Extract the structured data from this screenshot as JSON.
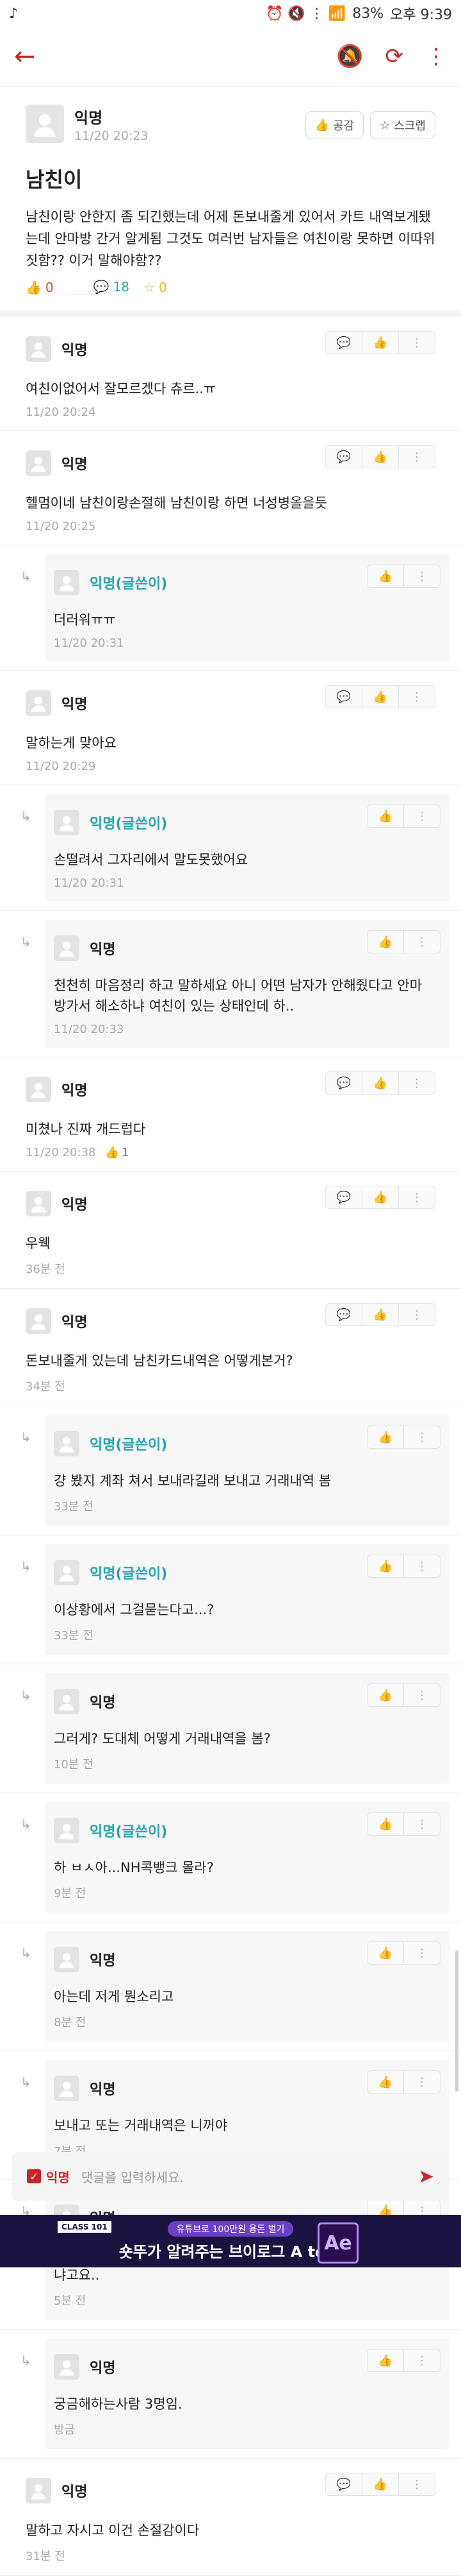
{
  "status": {
    "time": "오후 9:39",
    "battery": "83%"
  },
  "post": {
    "author": "익명",
    "date": "11/20 20:23",
    "empathy_label": "공감",
    "scrap_label": "스크랩",
    "title": "남친이",
    "body": "남친이랑 안한지 좀 되긴했는데 어제 돈보내줄게 있어서 카트 내역보게됐는데 안마방 간거 알게됨 그것도 여러번 남자들은 여친이랑 못하면 이따위짓함?? 이거 말해야함??",
    "likes": "0",
    "comments": "18",
    "scraps": "0"
  },
  "comments": [
    {
      "author": "익명",
      "text": "여친이없어서 잘모르겠다 츄르..ㅠ",
      "time": "11/20 20:24",
      "likes": ""
    },
    {
      "author": "익명",
      "text": "헬멈이네 남친이랑손절해 남친이랑 하면 너성병올을듯",
      "time": "11/20 20:25",
      "likes": "",
      "replies": [
        {
          "author": "익명(글쓴이)",
          "text": "더러워ㅠㅠ",
          "time": "11/20 20:31"
        }
      ]
    },
    {
      "author": "익명",
      "text": "말하는게 맞아요",
      "time": "11/20 20:29",
      "likes": "",
      "replies": [
        {
          "author": "익명(글쓴이)",
          "text": "손떨려서 그자리에서 말도못했어요",
          "time": "11/20 20:31"
        },
        {
          "author": "익명",
          "text": "천천히 마음정리 하고 말하세요 아니 어떤 남자가 안해줬다고 안마방가서 해소하냐 여친이 있는 상태인데 하..",
          "time": "11/20 20:33"
        }
      ]
    },
    {
      "author": "익명",
      "text": "미쳤나 진짜 개드럽다",
      "time": "11/20 20:38",
      "likes": "1"
    },
    {
      "author": "익명",
      "text": "우웩",
      "time": "36분 전",
      "likes": ""
    },
    {
      "author": "익명",
      "text": "돈보내줄게 있는데 남친카드내역은 어떻게본거?",
      "time": "34분 전",
      "likes": "",
      "replies": [
        {
          "author": "익명(글쓴이)",
          "text": "걍 봤지 계좌 쳐서 보내라길래 보내고 거래내역 봄",
          "time": "33분 전"
        },
        {
          "author": "익명(글쓴이)",
          "text": "이상황에서 그걸묻는다고...?",
          "time": "33분 전"
        },
        {
          "author": "익명",
          "text": "그러게? 도대체 어떻게 거래내역을 봄?",
          "time": "10분 전"
        },
        {
          "author": "익명(글쓴이)",
          "text": "하 ㅂㅅ아...NH콕뱅크 몰라?",
          "time": "9분 전"
        },
        {
          "author": "익명",
          "text": "아는데 저게 뭔소리고",
          "time": "8분 전"
        },
        {
          "author": "익명",
          "text": "보내고 또는 거래내역은 니꺼야",
          "time": "7분 전"
        },
        {
          "author": "익명",
          "text": "아니 남친 계좌로 돈을 보냈는데 남친 계좌 거래내역을 어떻게 보냐고요..",
          "time": "5분 전"
        },
        {
          "author": "익명",
          "text": "궁금해하는사람 3명임.",
          "time": "방금"
        }
      ]
    },
    {
      "author": "익명",
      "text": "말하고 자시고 이건 손절감이다",
      "time": "31분 전",
      "likes": ""
    }
  ],
  "write": {
    "anon_label": "익명",
    "placeholder": "댓글을 입력하세요."
  },
  "ad": {
    "badge": "CLASS 101",
    "tag": "유튜브로 100만원 용돈 벌기",
    "main": "숏뚜가 알려주는 브이로그 A to Z",
    "logo": "Ae"
  }
}
